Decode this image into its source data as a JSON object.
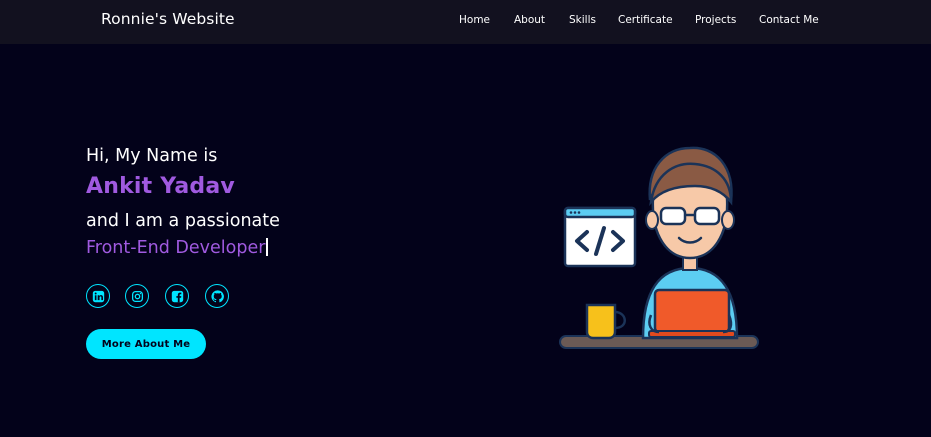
{
  "header": {
    "brand": "Ronnie's Website",
    "nav": [
      "Home",
      "About",
      "Skills",
      "Certificate",
      "Projects",
      "Contact Me"
    ]
  },
  "hero": {
    "greeting": "Hi, My Name is",
    "name": "Ankit Yadav",
    "intro": "and I am a passionate",
    "role": "Front-End Developer",
    "cta_label": "More About Me"
  },
  "socials": [
    "linkedin-icon",
    "instagram-icon",
    "facebook-icon",
    "github-icon"
  ],
  "colors": {
    "background": "#03021a",
    "navbar": "#12111f",
    "accent_cyan": "#00e5ff",
    "accent_purple": "#a05ae0"
  }
}
